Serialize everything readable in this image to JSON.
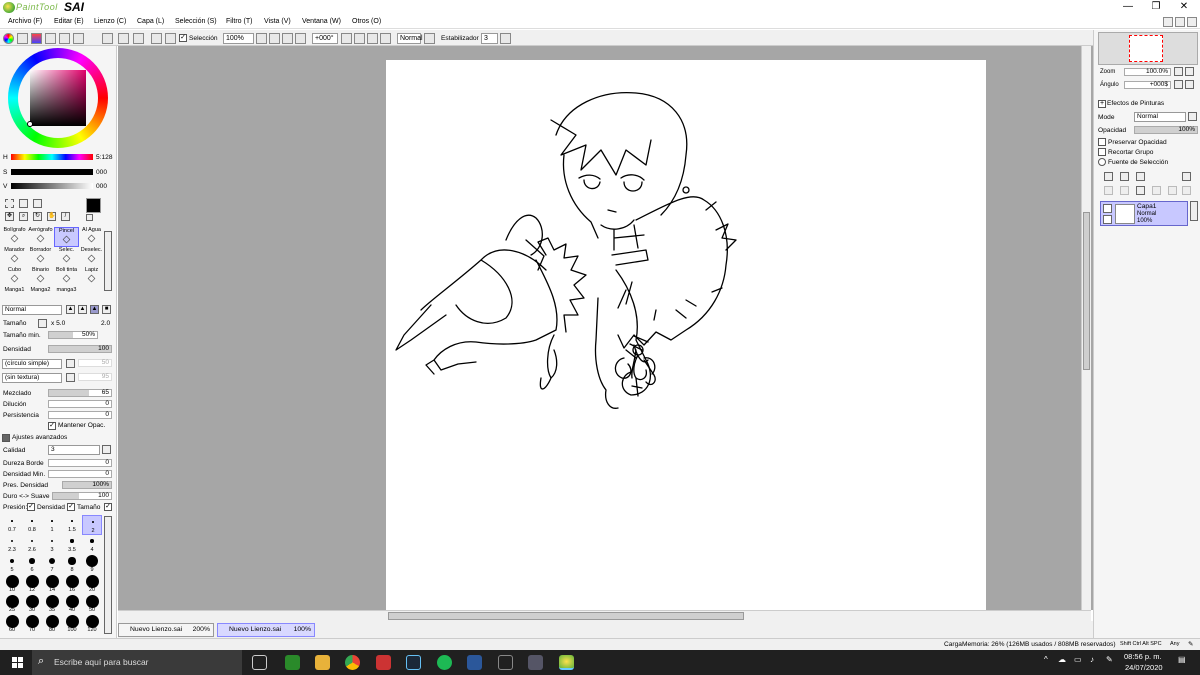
{
  "app": {
    "brand_small": "PaintTool",
    "brand_big": "SAI"
  },
  "window": {
    "minimize": "—",
    "restore": "❐",
    "close": "✕"
  },
  "menu": [
    "Archivo (F)",
    "Editar (E)",
    "Lienzo (C)",
    "Capa (L)",
    "Selección (S)",
    "Filtro (T)",
    "Vista (V)",
    "Ventana (W)",
    "Otros (O)"
  ],
  "toolbar": {
    "seleccion": "Selección",
    "zoom": "100%",
    "angle": "+000°",
    "blend": "Normal",
    "estabilizador_label": "Estabilizador",
    "estabilizador_value": "3"
  },
  "color": {
    "h_label": "H",
    "h_value": "5:128",
    "s_label": "S",
    "s_value": "000",
    "v_label": "V",
    "v_value": "000",
    "current": "#000000",
    "secondary": "#ffffff"
  },
  "tools": [
    "Bolígrafo",
    "Aerógrafo",
    "Pincel",
    "Al Agua",
    "Marador",
    "Borrador",
    "Selec.",
    "Deselec.",
    "Cubo",
    "Binario",
    "Boli tinta",
    "Lapiz",
    "Manga1",
    "Manga2",
    "manga3"
  ],
  "brush": {
    "mode": "Normal",
    "tamano_label": "Tamaño",
    "tamano_mult": "x 5.0",
    "tamano_value": "2.0",
    "tamano_min_label": "Tamaño min.",
    "tamano_min_value": "50%",
    "densidad_label": "Densidad",
    "densidad_value": "100",
    "shape": "(círculo simple)",
    "shape_value": "50",
    "texture": "(sin textura)",
    "texture_value": "95",
    "mezclado_label": "Mezclado",
    "mezclado_value": "65",
    "dilucion_label": "Dilución",
    "dilucion_value": "0",
    "persistencia_label": "Persistencia",
    "persistencia_value": "0",
    "mantener": "Mantener Opac.",
    "avanzados": "Ajustes avanzados",
    "calidad_label": "Calidad",
    "calidad_value": "3",
    "dureza_label": "Dureza Borde",
    "dureza_value": "0",
    "densmin_label": "Densidad Min.",
    "densmin_value": "0",
    "presdens_label": "Pres. Densidad",
    "presdens_value": "100%",
    "duro_label": "Duro <-> Suave",
    "duro_value": "100",
    "presion_label": "Presión:",
    "presion_dens": "Densidad",
    "presion_tam": "Tamaño"
  },
  "sizes": [
    "0.7",
    "0.8",
    "1",
    "1.5",
    "2",
    "2.3",
    "2.6",
    "3",
    "3.5",
    "4",
    "5",
    "6",
    "7",
    "8",
    "9",
    "10",
    "12",
    "14",
    "16",
    "20",
    "25",
    "30",
    "35",
    "40",
    "50",
    "60",
    "70",
    "80",
    "100",
    "120"
  ],
  "tabs": [
    {
      "name": "Nuevo Lienzo.sai",
      "zoom": "200%"
    },
    {
      "name": "Nuevo Lienzo.sai",
      "zoom": "100%"
    }
  ],
  "navigator": {
    "zoom_label": "Zoom",
    "zoom_value": "100.0%",
    "angle_label": "Ángulo",
    "angle_value": "+000$"
  },
  "layers": {
    "efectos": "Efectos de Pinturas",
    "mode_label": "Mode",
    "mode_value": "Normal",
    "opacidad_label": "Opacidad",
    "opacidad_value": "100%",
    "preservar": "Preservar Opacidad",
    "recortar": "Recortar Grupo",
    "fuente": "Fuente de Selección",
    "layer_name": "Capa1",
    "layer_mode": "Normal",
    "layer_opacity": "100%"
  },
  "status": {
    "memory": "CargaMemoria: 26% (126MB usados / 808MB reservados)",
    "keys": "Shift Ctrl Alt SPC",
    "any": "Any"
  },
  "taskbar": {
    "search": "Escribe aquí para buscar",
    "time": "08:56 p. m.",
    "date": "24/07/2020"
  }
}
